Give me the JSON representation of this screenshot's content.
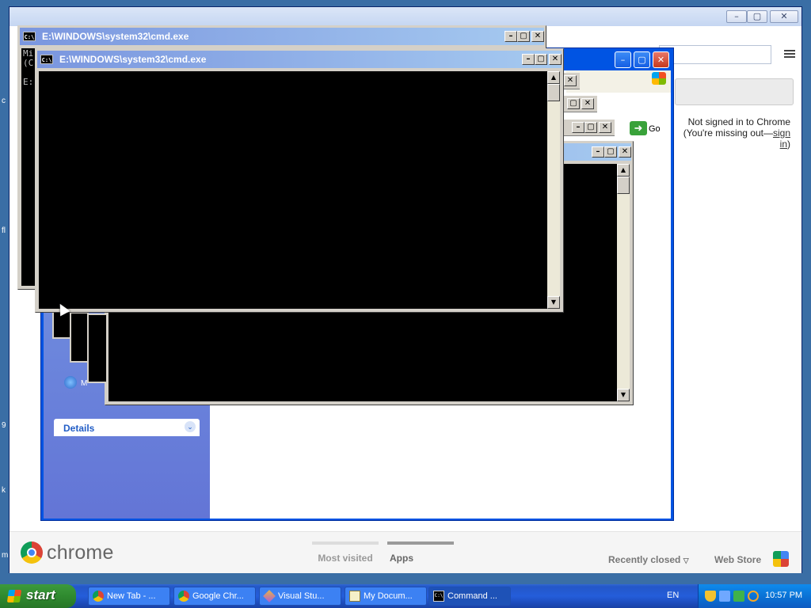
{
  "desktop": {
    "edge_chars": [
      "c",
      "fl",
      "9",
      "k",
      "m"
    ]
  },
  "chrome": {
    "window_buttons": [
      "–",
      "▢",
      "✕"
    ],
    "signin": {
      "line1": "Not signed in to Chrome",
      "line2_prefix": "(You're missing out—",
      "link": "sign in",
      "line2_suffix": ")"
    },
    "logo_text": "chrome",
    "ntp_tabs": [
      {
        "label": "Most visited",
        "active": false
      },
      {
        "label": "Apps",
        "active": true
      }
    ],
    "recently_closed": "Recently closed",
    "web_store": "Web Store"
  },
  "explorer": {
    "go_label": "Go",
    "details_label": "Details",
    "list_item_fragment": "M"
  },
  "cmd_windows": [
    {
      "title": "E:\\WINDOWS\\system32\\cmd.exe",
      "lines": [
        "Mi",
        "(C",
        "",
        "E:"
      ]
    },
    {
      "title": "E:\\WINDOWS\\system32\\cmd.exe",
      "lines": []
    }
  ],
  "taskbar": {
    "start_label": "start",
    "tasks": [
      {
        "label": "New Tab - ...",
        "icon": "chrome-icon"
      },
      {
        "label": "Google Chr...",
        "icon": "chrome-icon"
      },
      {
        "label": "Visual Stu...",
        "icon": "visual-studio-icon"
      },
      {
        "label": "My Docum...",
        "icon": "folder-icon"
      },
      {
        "label": "Command ...",
        "icon": "cmd-icon"
      }
    ],
    "language": "EN",
    "clock": "10:57 PM"
  },
  "colors": {
    "taskbar_blue": "#245dda",
    "start_green": "#2f8a2f",
    "cmd_title_blue": "#7a96df",
    "explorer_task_pane": "#6375d6"
  }
}
